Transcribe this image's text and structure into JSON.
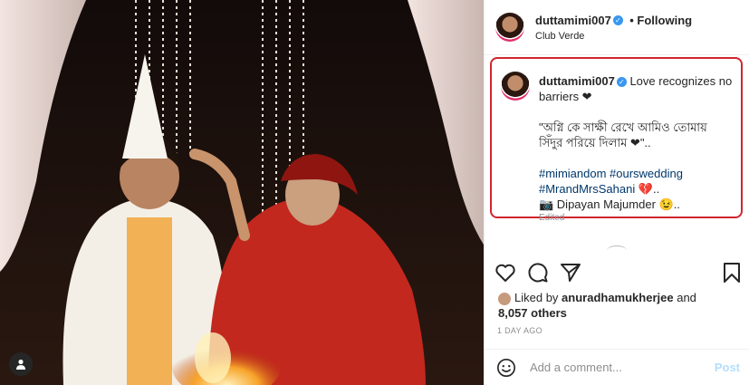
{
  "post": {
    "username": "duttamimi007",
    "follow_label": "• Following",
    "location": "Club Verde",
    "caption": {
      "username": "duttamimi007",
      "line1": "Love recognizes no barriers ❤",
      "bengali_line1": "\"অগ্নি কে সাক্ষী রেখে আমিও তোমায়",
      "bengali_line2": "সিঁদুর পরিয়ে দিলাম ❤\"..",
      "hashtags_line1": "#mimiandom #ourswedding",
      "hashtags_line2": "#MrandMrsSahani",
      "hashtags_suffix": "💔..",
      "credit": "📷 Dipayan Majumder 😉..",
      "credit_sub": "Edited"
    },
    "likes": {
      "liked_by_prefix": "Liked by",
      "liked_by_user": "anuradhamukherjee",
      "liked_by_and": "and",
      "others": "8,057 others"
    },
    "time": "1 DAY AGO",
    "comment": {
      "placeholder": "Add a comment...",
      "post_label": "Post"
    }
  },
  "icons": {
    "heart": "heart-icon",
    "comment": "comment-icon",
    "share": "share-icon",
    "save": "bookmark-icon",
    "emoji": "emoji-icon",
    "tag": "user-tag-icon"
  },
  "colors": {
    "highlight_border": "#d0262e",
    "verified": "#3897f0",
    "hashtag": "#00376b",
    "post_disabled": "#b2dffc"
  }
}
